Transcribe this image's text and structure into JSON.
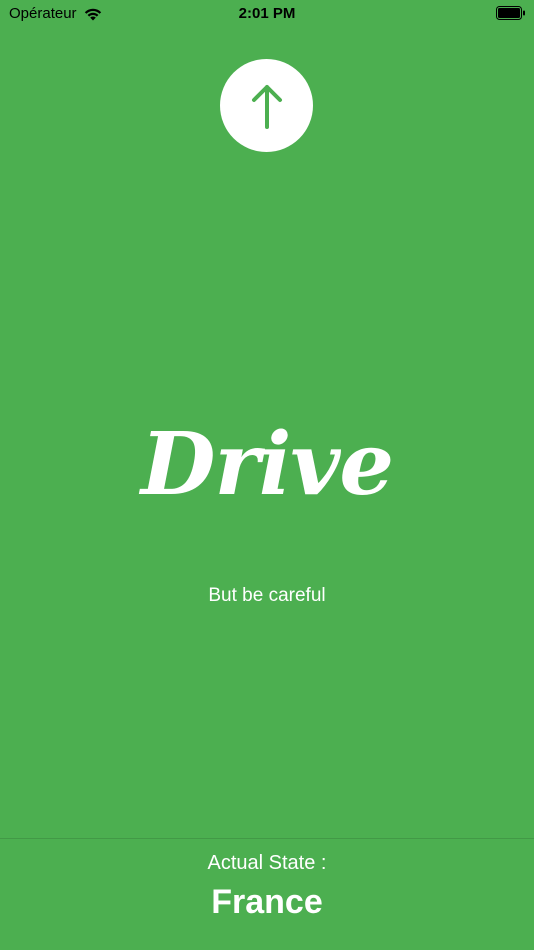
{
  "status_bar": {
    "carrier": "Opérateur",
    "time": "2:01 PM",
    "wifi_icon": "wifi-icon",
    "battery_icon": "battery-icon"
  },
  "main": {
    "up_button_icon": "arrow-up-icon",
    "title": "Drive",
    "subtitle": "But be careful"
  },
  "footer": {
    "state_label": "Actual State :",
    "state_value": "France"
  },
  "colors": {
    "background": "#4CAF50",
    "text": "#FFFFFF",
    "accent": "#4CAF50"
  }
}
